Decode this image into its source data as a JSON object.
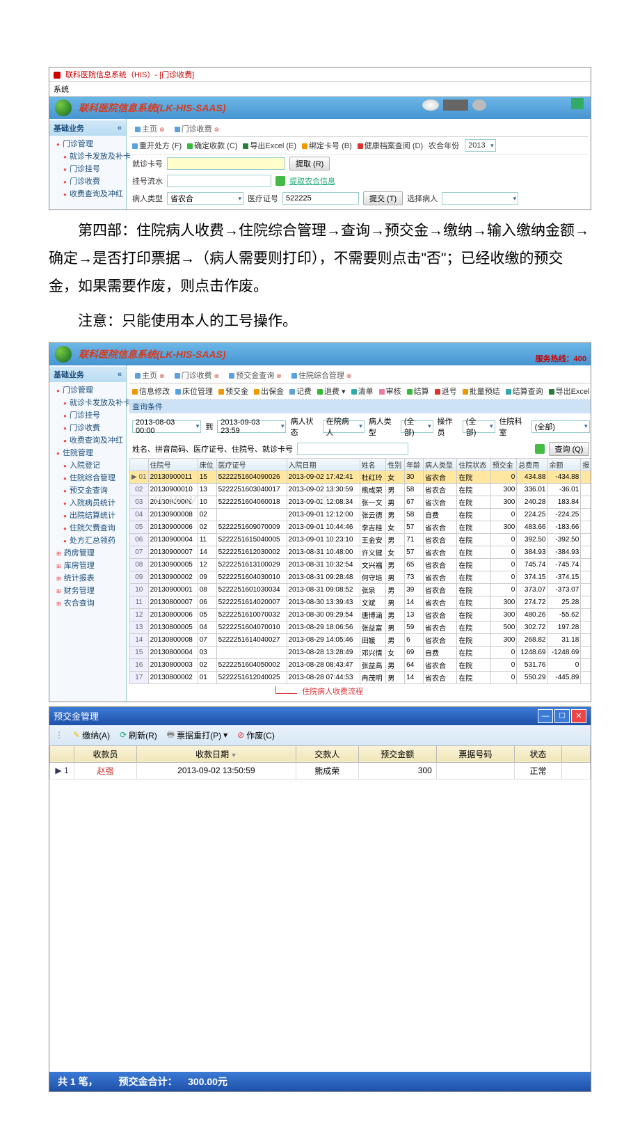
{
  "doc": {
    "para1": "第四部：住院病人收费→住院综合管理→查询→预交金→缴纳→输入缴纳金额→确定→是否打印票据→（病人需要则打印），不需要则点击\"否\"；已经收缴的预交金，如果需要作废，则点击作废。",
    "para2": "注意：只能使用本人的工号操作。"
  },
  "shot1": {
    "title": "联科医院信息系统（HIS）- [门诊收费]",
    "menu": "系统",
    "banner": "联科医院信息系统(LK-HIS-SAAS)",
    "sidebar_head": "基础业务",
    "tree": [
      "门诊管理",
      "就诊卡发放及补卡",
      "门诊挂号",
      "门诊收费",
      "收费查询及冲红"
    ],
    "tabs": {
      "home": "主页",
      "fee": "门诊收费"
    },
    "toolbar": {
      "reopen": "重开处方 (F)",
      "confirm": "确定收款 (C)",
      "export": "导出Excel (E)",
      "bind": "绑定卡号 (B)",
      "health": "健康档案查阅 (D)",
      "year_lbl": "农合年份",
      "year_val": "2013"
    },
    "form": {
      "card_lbl": "就诊卡号",
      "get_btn": "提取 (R)",
      "serial_lbl": "挂号流水",
      "farm_btn": "提取农合信息",
      "ptype_lbl": "病人类型",
      "ptype_val": "省农合",
      "cert_lbl": "医疗证号",
      "cert_val": "522225",
      "submit": "提交 (T)",
      "select_lbl": "选择病人"
    }
  },
  "shot2": {
    "banner": "联科医院信息系统(LK-HIS-SAAS)",
    "hotline": "服务热线：400",
    "sidebar_head": "基础业务",
    "tree_menzhen": [
      "门诊管理",
      "就诊卡发放及补卡",
      "门诊挂号",
      "门诊收费",
      "收费查询及冲红"
    ],
    "tree_zhuyuan_head": "住院管理",
    "tree_zhuyuan": [
      "入院登记",
      "住院综合管理",
      "预交金查询",
      "入院病员统计",
      "出院结算统计",
      "住院欠费查询",
      "处方汇总领药"
    ],
    "tree_others": [
      "药房管理",
      "库房管理",
      "统计报表",
      "财务管理",
      "农合查询"
    ],
    "tabs": {
      "home": "主页",
      "mz": "门诊收费",
      "yj": "预交金查询",
      "zh": "住院综合管理"
    },
    "toolbar": {
      "edit": "信息修改",
      "bed": "床位管理",
      "yjj": "预交金",
      "deposit": "出保金",
      "write": "记费",
      "ret": "退费",
      "list": "清单",
      "audit": "审核",
      "settle": "结算",
      "logout": "退号",
      "batch": "批量预结",
      "recal": "结算查询",
      "export": "导出Excel"
    },
    "query_bar_label": "查询条件",
    "filter": {
      "from": "2013-08-03 00:00",
      "to_lbl": "到",
      "to": "2013-09-03 23:59",
      "status_lbl": "病人状态",
      "status_val": "在院病人",
      "ptype_lbl": "病人类型",
      "ptype_val": "(全部)",
      "op_lbl": "操作员",
      "op_val": "(全部)",
      "dept_lbl": "住院科室",
      "dept_val": "(全部)",
      "search_lbl": "姓名、拼音简码、医疗证号、住院号、就诊卡号",
      "refresh": "刷新",
      "query": "查询 (Q)"
    },
    "cols": [
      "",
      "住院号",
      "床位",
      "医疗证号",
      "入院日期",
      "姓名",
      "性别",
      "年龄",
      "病人类型",
      "住院状态",
      "预交金",
      "总费用",
      "余额",
      "报"
    ],
    "rows": [
      {
        "n": "01",
        "id": "20130900011",
        "bed": "15",
        "cert": "5222251604090026",
        "date": "2013-09-02 17:42:41",
        "name": "杜红玲",
        "sex": "女",
        "age": "30",
        "type": "省农合",
        "stat": "在院",
        "pre": "0",
        "cost": "434.88",
        "bal": "-434.88",
        "sel": true
      },
      {
        "n": "02",
        "id": "20130900010",
        "bed": "13",
        "cert": "5222251603040017",
        "date": "2013-09-02 13:30:59",
        "name": "熊成荣",
        "sex": "男",
        "age": "58",
        "type": "省农合",
        "stat": "在院",
        "pre": "300",
        "cost": "336.01",
        "bal": "-36.01"
      },
      {
        "n": "03",
        "id": "20130900009",
        "bed": "10",
        "cert": "5222251604060018",
        "date": "2013-09-02 12:08:34",
        "name": "张一文",
        "sex": "男",
        "age": "67",
        "type": "省农合",
        "stat": "在院",
        "pre": "300",
        "cost": "240.28",
        "bal": "183.84"
      },
      {
        "n": "04",
        "id": "20130900008",
        "bed": "02",
        "cert": "",
        "date": "2013-09-01 12:12:00",
        "name": "张云德",
        "sex": "男",
        "age": "58",
        "type": "自费",
        "stat": "在院",
        "pre": "0",
        "cost": "224.25",
        "bal": "-224.25"
      },
      {
        "n": "05",
        "id": "20130900006",
        "bed": "02",
        "cert": "5222251609070009",
        "date": "2013-09-01 10:44:46",
        "name": "李吉桂",
        "sex": "女",
        "age": "57",
        "type": "省农合",
        "stat": "在院",
        "pre": "300",
        "cost": "483.66",
        "bal": "-183.66"
      },
      {
        "n": "06",
        "id": "20130900004",
        "bed": "11",
        "cert": "5222251615040005",
        "date": "2013-09-01 10:23:10",
        "name": "王金安",
        "sex": "男",
        "age": "71",
        "type": "省农合",
        "stat": "在院",
        "pre": "0",
        "cost": "392.50",
        "bal": "-392.50"
      },
      {
        "n": "07",
        "id": "20130900007",
        "bed": "14",
        "cert": "5222251612030002",
        "date": "2013-08-31 10:48:00",
        "name": "许义健",
        "sex": "女",
        "age": "57",
        "type": "省农合",
        "stat": "在院",
        "pre": "0",
        "cost": "384.93",
        "bal": "-384.93"
      },
      {
        "n": "08",
        "id": "20130900005",
        "bed": "12",
        "cert": "5222251613100029",
        "date": "2013-08-31 10:32:54",
        "name": "文兴福",
        "sex": "男",
        "age": "65",
        "type": "省农合",
        "stat": "在院",
        "pre": "0",
        "cost": "745.74",
        "bal": "-745.74"
      },
      {
        "n": "09",
        "id": "20130900002",
        "bed": "09",
        "cert": "5222251604030010",
        "date": "2013-08-31 09:28:48",
        "name": "何守培",
        "sex": "男",
        "age": "73",
        "type": "省农合",
        "stat": "在院",
        "pre": "0",
        "cost": "374.15",
        "bal": "-374.15"
      },
      {
        "n": "10",
        "id": "20130900001",
        "bed": "08",
        "cert": "5222251601030034",
        "date": "2013-08-31 09:08:52",
        "name": "张泉",
        "sex": "男",
        "age": "39",
        "type": "省农合",
        "stat": "在院",
        "pre": "0",
        "cost": "373.07",
        "bal": "-373.07"
      },
      {
        "n": "11",
        "id": "20130800007",
        "bed": "06",
        "cert": "5222251614020007",
        "date": "2013-08-30 13:39:43",
        "name": "文斌",
        "sex": "男",
        "age": "14",
        "type": "省农合",
        "stat": "在院",
        "pre": "300",
        "cost": "274.72",
        "bal": "25.28"
      },
      {
        "n": "12",
        "id": "20130800006",
        "bed": "05",
        "cert": "5222251610070032",
        "date": "2013-08-30 09:29:54",
        "name": "唐博涵",
        "sex": "男",
        "age": "13",
        "type": "省农合",
        "stat": "在院",
        "pre": "300",
        "cost": "480.26",
        "bal": "-55.62"
      },
      {
        "n": "13",
        "id": "20130800005",
        "bed": "04",
        "cert": "5222251604070010",
        "date": "2013-08-29 18:06:56",
        "name": "张益富",
        "sex": "男",
        "age": "59",
        "type": "省农合",
        "stat": "在院",
        "pre": "500",
        "cost": "302.72",
        "bal": "197.28"
      },
      {
        "n": "14",
        "id": "20130800008",
        "bed": "07",
        "cert": "5222251614040027",
        "date": "2013-08-29 14:05:46",
        "name": "田媛",
        "sex": "男",
        "age": "6",
        "type": "省农合",
        "stat": "在院",
        "pre": "300",
        "cost": "268.82",
        "bal": "31.18"
      },
      {
        "n": "15",
        "id": "20130800004",
        "bed": "03",
        "cert": "",
        "date": "2013-08-28 13:28:49",
        "name": "邓兴情",
        "sex": "女",
        "age": "69",
        "type": "自费",
        "stat": "在院",
        "pre": "0",
        "cost": "1248.69",
        "bal": "-1248.69"
      },
      {
        "n": "16",
        "id": "20130800003",
        "bed": "02",
        "cert": "5222251604050002",
        "date": "2013-08-28 08:43:47",
        "name": "张益高",
        "sex": "男",
        "age": "64",
        "type": "省农合",
        "stat": "在院",
        "pre": "0",
        "cost": "531.76",
        "bal": "0"
      },
      {
        "n": "17",
        "id": "20130800002",
        "bed": "01",
        "cert": "5222251612040025",
        "date": "2013-08-28 07:44:53",
        "name": "冉茂明",
        "sex": "男",
        "age": "14",
        "type": "省农合",
        "stat": "在院",
        "pre": "0",
        "cost": "550.29",
        "bal": "-445.89"
      }
    ],
    "arrow_note": "住院病人收费流程"
  },
  "shot3": {
    "title": "预交金管理",
    "tb": {
      "pay": "缴纳(A)",
      "refresh": "刷新(R)",
      "reprint": "票据重打(P)",
      "void": "作废(C)"
    },
    "cols": {
      "cashier": "收款员",
      "date": "收款日期",
      "payer": "交款人",
      "amount": "预交金额",
      "ticket": "票据号码",
      "status": "状态"
    },
    "row": {
      "n": "1",
      "cashier": "赵强",
      "date": "2013-09-02 13:50:59",
      "payer": "熊成荣",
      "amount": "300",
      "status": "正常"
    },
    "footer": {
      "count_lbl": "共",
      "count": "1",
      "count_unit": "笔，",
      "sum_lbl": "预交金合计：",
      "sum": "300.00元"
    }
  }
}
